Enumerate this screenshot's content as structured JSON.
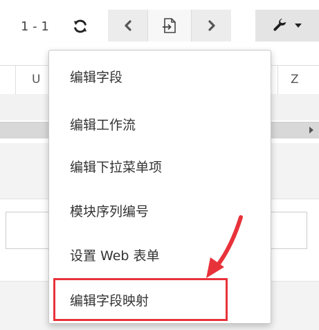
{
  "toolbar": {
    "pager_count": "1 - 1",
    "refresh_icon": "refresh-icon",
    "prev_icon": "chevron-left-icon",
    "import_icon": "import-file-icon",
    "next_icon": "chevron-right-icon",
    "settings_icon": "wrench-icon",
    "dropdown_icon": "caret-down-icon"
  },
  "grid": {
    "columns": [
      "U",
      "Z"
    ]
  },
  "menu": {
    "items": [
      {
        "label": "编辑字段"
      },
      {
        "label": "编辑工作流"
      },
      {
        "label": "编辑下拉菜单项"
      },
      {
        "label": "模块序列编号"
      },
      {
        "label": "设置 Web 表单"
      },
      {
        "label": "编辑字段映射"
      }
    ],
    "highlighted_item_index": 5
  },
  "colors": {
    "annotation_red": "#e8323a",
    "button_gray": "#ececec",
    "menu_border": "#c8c8c8"
  }
}
